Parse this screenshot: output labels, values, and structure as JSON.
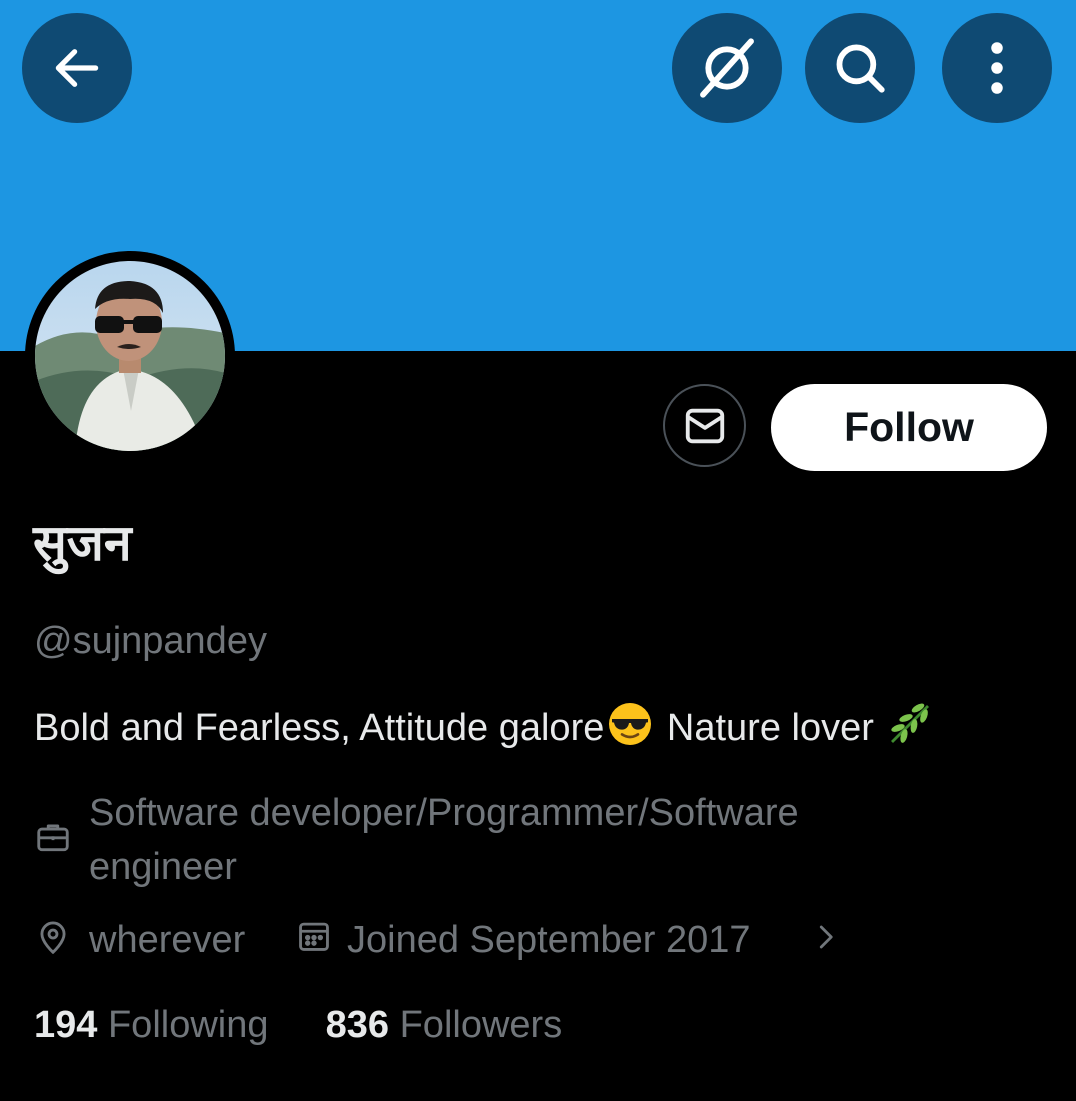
{
  "header": {
    "back_icon": "arrow-left-icon",
    "grok_icon": "grok-icon",
    "search_icon": "search-icon",
    "more_icon": "more-vertical-icon",
    "banner_color": "#1d96e2"
  },
  "profile": {
    "display_name": "सुजन",
    "handle": "@sujnpandey",
    "bio_part1": "Bold and Fearless, Attitude galore",
    "bio_part2": " Nature lover ",
    "bio_emojis": [
      "sunglasses-emoji",
      "herb-emoji"
    ],
    "profession_line1": "Software developer/Programmer/Software",
    "profession_line2": "engineer",
    "location": "wherever",
    "joined": "Joined September 2017"
  },
  "actions": {
    "message_icon": "envelope-icon",
    "follow_label": "Follow"
  },
  "stats": {
    "following_count": "194",
    "following_label": "Following",
    "followers_count": "836",
    "followers_label": "Followers"
  }
}
